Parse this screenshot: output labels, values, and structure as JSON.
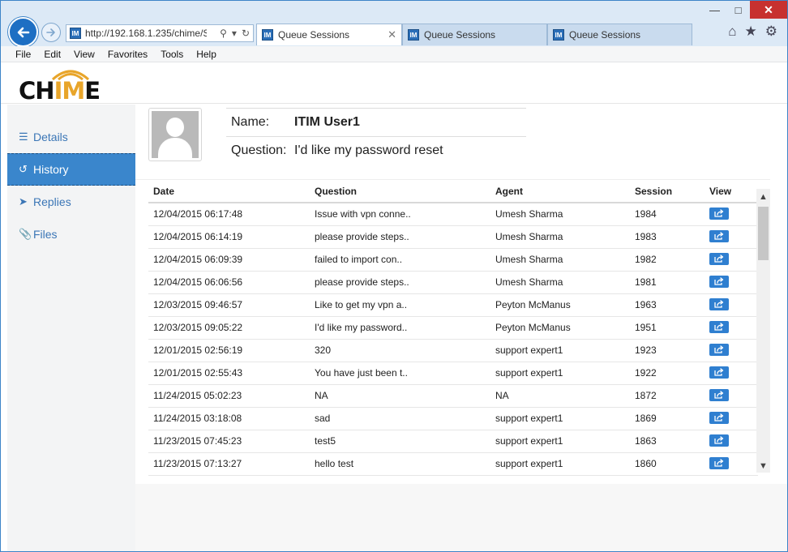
{
  "browser": {
    "url": "http://192.168.1.235/chime/S",
    "tabs": [
      {
        "label": "Queue Sessions"
      },
      {
        "label": "Queue Sessions"
      },
      {
        "label": "Queue Sessions"
      }
    ],
    "favicon_text": "IM"
  },
  "menu": [
    "File",
    "Edit",
    "View",
    "Favorites",
    "Tools",
    "Help"
  ],
  "logo": {
    "prefix": "CH",
    "highlight": "IM",
    "suffix": "E"
  },
  "sidebar": {
    "items": [
      {
        "label": "Details",
        "icon": "list-icon"
      },
      {
        "label": "History",
        "icon": "history-icon"
      },
      {
        "label": "Replies",
        "icon": "send-icon"
      },
      {
        "label": "Files",
        "icon": "paperclip-icon"
      }
    ],
    "active": "History"
  },
  "user": {
    "name_label": "Name:",
    "name": "ITIM User1",
    "question_label": "Question:",
    "question": "I'd like my password reset"
  },
  "table": {
    "headers": [
      "Date",
      "Question",
      "Agent",
      "Session",
      "View"
    ],
    "rows": [
      {
        "date": "12/04/2015 06:17:48",
        "question": "Issue with vpn conne..",
        "agent": "Umesh Sharma",
        "session": "1984"
      },
      {
        "date": "12/04/2015 06:14:19",
        "question": "please provide steps..",
        "agent": "Umesh Sharma",
        "session": "1983"
      },
      {
        "date": "12/04/2015 06:09:39",
        "question": "failed to import con..",
        "agent": "Umesh Sharma",
        "session": "1982"
      },
      {
        "date": "12/04/2015 06:06:56",
        "question": "please provide steps..",
        "agent": "Umesh Sharma",
        "session": "1981"
      },
      {
        "date": "12/03/2015 09:46:57",
        "question": "Like to get my vpn a..",
        "agent": "Peyton McManus",
        "session": "1963"
      },
      {
        "date": "12/03/2015 09:05:22",
        "question": "I'd like my password..",
        "agent": "Peyton McManus",
        "session": "1951"
      },
      {
        "date": "12/01/2015 02:56:19",
        "question": "320",
        "agent": "support expert1",
        "session": "1923"
      },
      {
        "date": "12/01/2015 02:55:43",
        "question": "You have just been t..",
        "agent": "support expert1",
        "session": "1922"
      },
      {
        "date": "11/24/2015 05:02:23",
        "question": "NA",
        "agent": "NA",
        "session": "1872"
      },
      {
        "date": "11/24/2015 03:18:08",
        "question": "sad",
        "agent": "support expert1",
        "session": "1869"
      },
      {
        "date": "11/23/2015 07:45:23",
        "question": "test5",
        "agent": "support expert1",
        "session": "1863"
      },
      {
        "date": "11/23/2015 07:13:27",
        "question": "hello test",
        "agent": "support expert1",
        "session": "1860"
      }
    ]
  },
  "colors": {
    "accent": "#3a86cc",
    "link": "#3b76b6",
    "logo_highlight": "#e8a52a",
    "close_button": "#c7312f"
  }
}
